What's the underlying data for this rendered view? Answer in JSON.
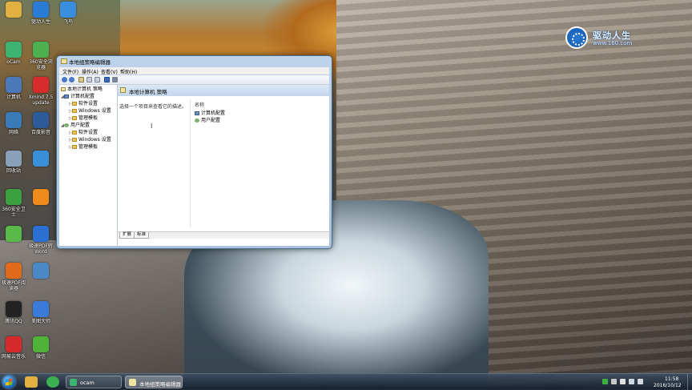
{
  "desktop": {
    "icons": [
      {
        "label": "",
        "icon": "folder-icon",
        "color": "#e0b040"
      },
      {
        "label": "驱动人生",
        "icon": "app-icon-blue",
        "color": "#2a7bd6"
      },
      {
        "label": "飞鸟",
        "icon": "bird-app-icon",
        "color": "#3a8ee0"
      },
      {
        "label": "oCam",
        "icon": "ocam-icon",
        "color": "#3cb371"
      },
      {
        "label": "360安全浏览器",
        "icon": "browser-360-icon",
        "color": "#4caf50"
      },
      {
        "label": "计算机",
        "icon": "computer-icon",
        "color": "#4a78b8"
      },
      {
        "label": "Xmind 7.5 update",
        "icon": "xmind-icon",
        "color": "#d92b2b"
      },
      {
        "label": "网络",
        "icon": "network-icon",
        "color": "#3a7ab8"
      },
      {
        "label": "百度影音",
        "icon": "video-player-icon",
        "color": "#2d5b9a"
      },
      {
        "label": "回收站",
        "icon": "recycle-bin-icon",
        "color": "#8aa0b8"
      },
      {
        "label": "",
        "icon": "puzzle-app-icon",
        "color": "#3a90d8"
      },
      {
        "label": "360安全卫士",
        "icon": "security-shield-icon",
        "color": "#3aa040"
      },
      {
        "label": "",
        "icon": "flash-app-icon",
        "color": "#f08a1a"
      },
      {
        "label": "",
        "icon": "cat-app-icon",
        "color": "#58b848"
      },
      {
        "label": "极速PDF转Word",
        "icon": "pdf-word-icon",
        "color": "#2b6fd0"
      },
      {
        "label": "极速PDF阅读器",
        "icon": "pdf-reader-icon",
        "color": "#e06a1a"
      },
      {
        "label": "",
        "icon": "check-doc-icon",
        "color": "#4a88c8"
      },
      {
        "label": "腾讯QQ",
        "icon": "qq-penguin-icon",
        "color": "#222222"
      },
      {
        "label": "美图大师",
        "icon": "photo-app-icon",
        "color": "#3a7ad8"
      },
      {
        "label": "网易云音乐",
        "icon": "music-app-icon",
        "color": "#d62a2a"
      },
      {
        "label": "微信",
        "icon": "wechat-icon",
        "color": "#4fb33a"
      }
    ]
  },
  "watermark": {
    "title": "驱动人生",
    "url": "www.160.com"
  },
  "window": {
    "title": "本地组策略编辑器",
    "menu": [
      "文件(F)",
      "操作(A)",
      "查看(V)",
      "帮助(H)"
    ],
    "tree": {
      "root": "本地计算机 策略",
      "computer_config": "计算机配置",
      "computer_children": [
        "软件设置",
        "Windows 设置",
        "管理模板"
      ],
      "user_config": "用户配置",
      "user_children": [
        "软件设置",
        "Windows 设置",
        "管理模板"
      ]
    },
    "content": {
      "header": "本地计算机 策略",
      "description": "选择一个项目来查看它的描述。",
      "column_name": "名称",
      "rows": [
        "计算机配置",
        "用户配置"
      ]
    },
    "tabs": [
      "扩展",
      "标准"
    ]
  },
  "taskbar": {
    "tasks": [
      {
        "label": "ocam",
        "icon": "ocam-task-icon",
        "color": "#3cb371"
      },
      {
        "label": "本地组策略编辑器",
        "icon": "gpedit-task-icon",
        "color": "#f1e3a0"
      }
    ],
    "clock": {
      "time": "11:58",
      "date": "2016/10/12"
    },
    "accent": "#1f6fc0"
  }
}
